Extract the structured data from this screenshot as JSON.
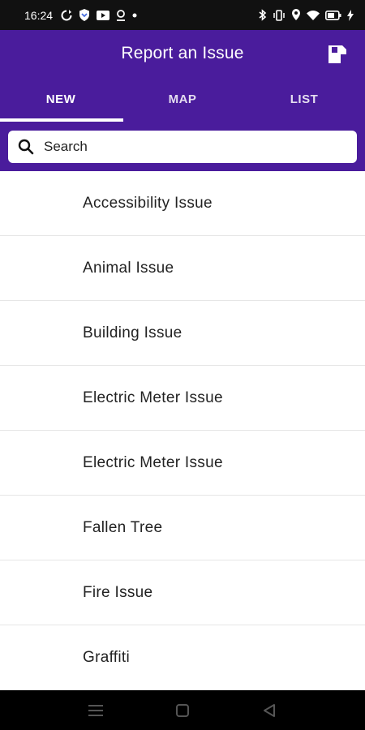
{
  "status_bar": {
    "time": "16:24",
    "left_icons": [
      "sync-icon",
      "shield-icon",
      "video-icon",
      "location-icon",
      "dot-icon"
    ],
    "right_icons": [
      "bluetooth-icon",
      "vibrate-icon",
      "location-pin-icon",
      "wifi-icon",
      "battery-icon"
    ]
  },
  "header": {
    "title": "Report an Issue",
    "save_icon": "save-icon",
    "background": "#4a1c9c"
  },
  "tabs": [
    {
      "label": "NEW",
      "active": true
    },
    {
      "label": "MAP",
      "active": false
    },
    {
      "label": "LIST",
      "active": false
    }
  ],
  "search": {
    "placeholder": "Search",
    "value": ""
  },
  "issues": [
    {
      "label": "Accessibility Issue"
    },
    {
      "label": "Animal Issue"
    },
    {
      "label": "Building Issue"
    },
    {
      "label": "Electric Meter Issue"
    },
    {
      "label": "Electric Meter Issue"
    },
    {
      "label": "Fallen Tree"
    },
    {
      "label": "Fire Issue"
    },
    {
      "label": "Graffiti"
    }
  ],
  "nav_bar": {
    "buttons": [
      "menu-icon",
      "home-icon",
      "back-icon"
    ]
  }
}
